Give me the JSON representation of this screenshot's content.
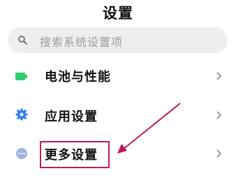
{
  "header": {
    "title": "设置"
  },
  "search": {
    "placeholder": "搜索系统设置项",
    "icon": "search-icon"
  },
  "settings_items": [
    {
      "label": "电池与性能",
      "icon": "battery-icon",
      "icon_color": "#2ecc71"
    },
    {
      "label": "应用设置",
      "icon": "gear-icon",
      "icon_color": "#2f80ed"
    },
    {
      "label": "更多设置",
      "icon": "more-dots-icon",
      "icon_color": "#9fb4dd"
    }
  ],
  "annotation": {
    "color": "#c2185b",
    "target": "更多设置"
  }
}
